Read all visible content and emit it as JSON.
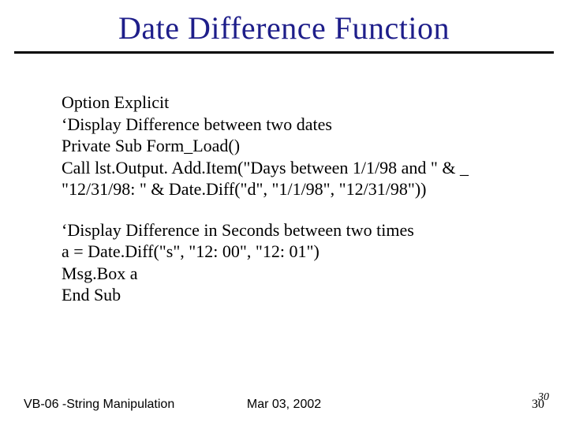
{
  "title": "Date Difference  Function",
  "body": {
    "block1": {
      "l1": "Option Explicit",
      "l2": "‘Display Difference between two dates",
      "l3": "Private Sub Form_Load()",
      "l4": "Call lst.Output. Add.Item(\"Days between 1/1/98 and \" & _",
      "l5": "\"12/31/98: \" & Date.Diff(\"d\", \"1/1/98\", \"12/31/98\"))"
    },
    "block2": {
      "l1": "‘Display Difference in Seconds between two times",
      "l2": "a = Date.Diff(\"s\", \"12: 00\", \"12: 01\")",
      "l3": "Msg.Box a",
      "l4": "End Sub"
    }
  },
  "footer": {
    "left": "VB-06 -String Manipulation",
    "center": "Mar 03, 2002",
    "page_main": "30",
    "page_overlay": "30"
  }
}
